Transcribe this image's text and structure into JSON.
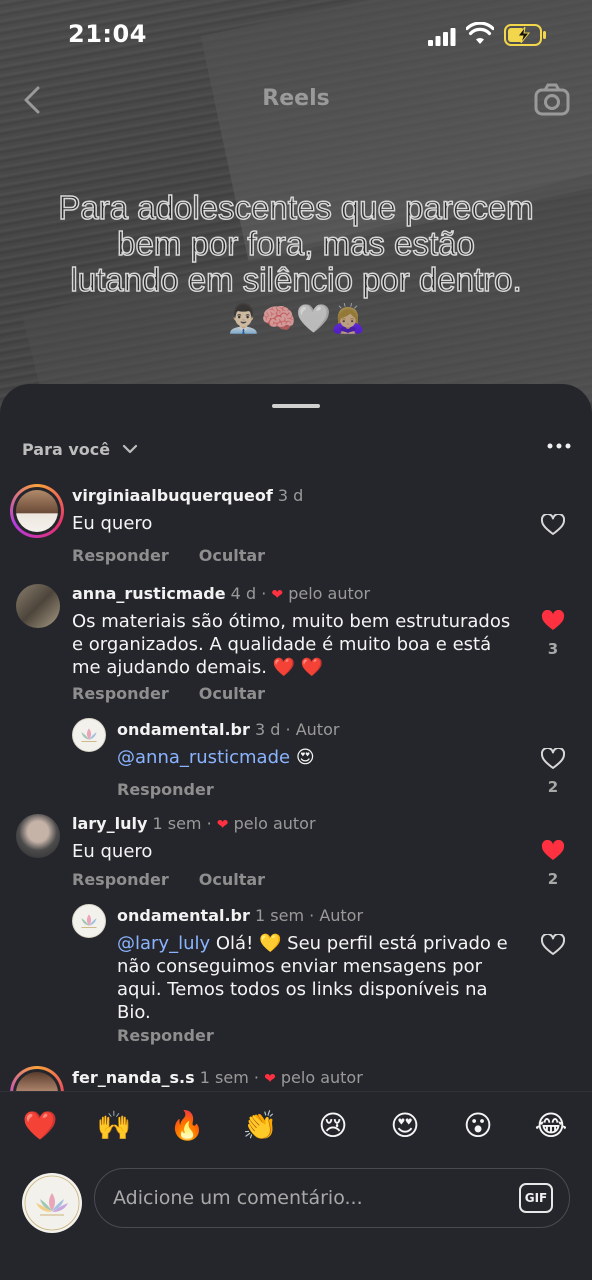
{
  "status": {
    "time": "21:04"
  },
  "reel": {
    "title": "Reels",
    "caption_lines": [
      "Para adolescentes que parecem",
      "bem por fora, mas estão",
      "lutando em silêncio por dentro."
    ],
    "emojis": "👨🏻‍💼🧠🤍🙇🏼‍♀️"
  },
  "sheet": {
    "filter_label": "Para você"
  },
  "comments": [
    {
      "user": "virginiaalbuquerqueof",
      "time": "3 d",
      "tag": "",
      "text": "Eu quero",
      "reply": "Responder",
      "hide": "Ocultar",
      "liked": false,
      "likes": ""
    },
    {
      "user": "anna_rusticmade",
      "time": "4 d",
      "tag": "pelo autor",
      "text": "Os materiais são ótimo, muito bem estruturados e organizados. A qualidade é muito boa e está me ajudando demais. ❤️ ❤️",
      "reply": "Responder",
      "hide": "Ocultar",
      "liked": true,
      "likes": "3"
    },
    {
      "user": "ondamental.br",
      "time": "3 d",
      "tag": "Autor",
      "mention": "@anna_rusticmade",
      "text": " 😍",
      "reply": "Responder",
      "liked": false,
      "likes": "2"
    },
    {
      "user": "lary_luly",
      "time": "1 sem",
      "tag": "pelo autor",
      "text": "Eu quero",
      "reply": "Responder",
      "hide": "Ocultar",
      "liked": true,
      "likes": "2"
    },
    {
      "user": "ondamental.br",
      "time": "1 sem",
      "tag": "Autor",
      "mention": "@lary_luly",
      "text": " Olá! 💛 Seu perfil está privado e não conseguimos enviar mensagens por aqui. Temos todos os links disponíveis na Bio.",
      "reply": "Responder",
      "liked": false,
      "likes": ""
    },
    {
      "user": "fer_nanda_s.s",
      "time": "1 sem",
      "tag": "pelo autor"
    }
  ],
  "quick_emojis": [
    "❤️",
    "🙌",
    "🔥",
    "👏",
    "😢",
    "😍",
    "😮",
    "😂"
  ],
  "input": {
    "placeholder": "Adicione um comentário...",
    "gif_label": "GIF"
  },
  "colors": {
    "sheet_bg": "#25262b",
    "accent_red": "#ff3040",
    "mention": "#8ab4ff"
  }
}
